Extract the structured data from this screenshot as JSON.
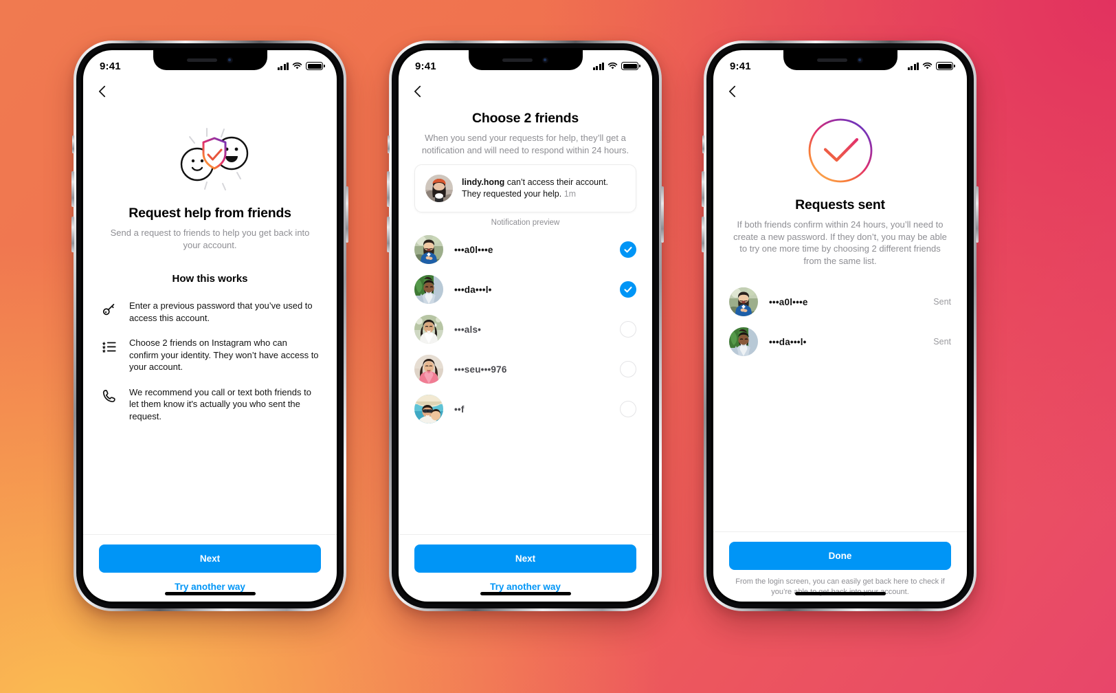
{
  "background": {
    "gradient_colors": [
      "#F07A50",
      "#E2325F",
      "#FBBE52",
      "#F0714F"
    ]
  },
  "theme": {
    "accent_blue": "#0095F6",
    "text_primary": "#111111",
    "text_secondary": "#8E8E93",
    "divider": "#EDEDED"
  },
  "status_bar": {
    "time": "9:41",
    "signal_icon": "cellular-signal-icon",
    "wifi_icon": "wifi-icon",
    "battery_icon": "battery-icon"
  },
  "phones": [
    {
      "id": "phone-1",
      "screen": "request-help-from-friends",
      "back_icon": "back-chevron-icon",
      "hero_illustration": "two-faces-with-shield-check-icon",
      "title": "Request help from friends",
      "subtitle": "Send a request to friends to help you get back into your account.",
      "section_title": "How this works",
      "steps": [
        {
          "icon": "key-icon",
          "text": "Enter a previous password that you’ve used to access this account."
        },
        {
          "icon": "list-icon",
          "text": "Choose 2 friends on Instagram who can confirm your identity. They won’t have access to your account."
        },
        {
          "icon": "phone-icon",
          "text": "We recommend you call or text both friends to let them know it's actually you who sent the request."
        }
      ],
      "primary_button": "Next",
      "secondary_link": "Try another way"
    },
    {
      "id": "phone-2",
      "screen": "choose-2-friends",
      "back_icon": "back-chevron-icon",
      "title": "Choose 2 friends",
      "subtitle": "When you send your requests for help, they’ll get a notification and will need to respond within 24 hours.",
      "notification": {
        "avatar": "avatar-lindy-hong",
        "username": "lindy.hong",
        "message": " can’t access their account. They requested your help. ",
        "time": "1m"
      },
      "notification_caption": "Notification preview",
      "friends": [
        {
          "avatar": "avatar-friend-1",
          "name": "•••a0l•••e",
          "selected": true
        },
        {
          "avatar": "avatar-friend-2",
          "name": "•••da•••l•",
          "selected": true
        },
        {
          "avatar": "avatar-friend-3",
          "name": "•••als•",
          "selected": false
        },
        {
          "avatar": "avatar-friend-4",
          "name": "•••seu•••976",
          "selected": false
        },
        {
          "avatar": "avatar-friend-5",
          "name": "••f",
          "selected": false
        }
      ],
      "primary_button": "Next",
      "secondary_link": "Try another way"
    },
    {
      "id": "phone-3",
      "screen": "requests-sent",
      "back_icon": "back-chevron-icon",
      "hero_illustration": "gradient-circle-check-icon",
      "title": "Requests sent",
      "subtitle": "If both friends confirm within 24 hours, you’ll need to create a new password. If they don’t, you may be able to try one more time by choosing 2 different friends from the same list.",
      "sent_list": [
        {
          "avatar": "avatar-friend-1",
          "name": "•••a0l•••e",
          "status": "Sent"
        },
        {
          "avatar": "avatar-friend-2",
          "name": "•••da•••l•",
          "status": "Sent"
        }
      ],
      "primary_button": "Done",
      "footnote": "From the login screen, you can easily get back here to check if you’re able to get back into your account."
    }
  ]
}
